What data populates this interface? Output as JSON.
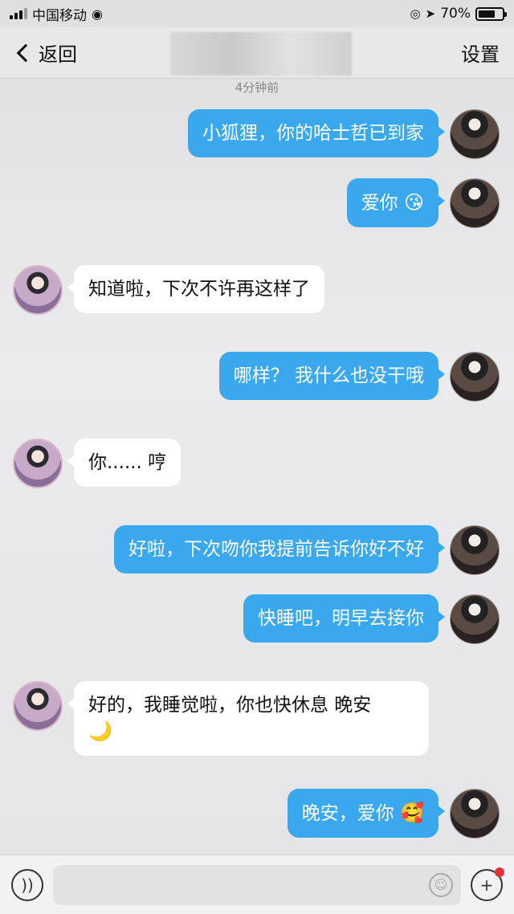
{
  "status_bar": {
    "carrier": "中国移动",
    "battery": "70%",
    "battery_level": 0.7
  },
  "nav": {
    "back_label": "返回",
    "settings_label": "设置"
  },
  "chat": {
    "timestamp": "4分钟前",
    "messages": [
      {
        "side": "out",
        "text": "小狐狸，你的哈士哲已到家",
        "emoji": ""
      },
      {
        "side": "out",
        "text": "爱你",
        "emoji": "😘"
      },
      {
        "side": "in",
        "text": "知道啦，下次不许再这样了",
        "emoji": ""
      },
      {
        "side": "out",
        "text": "哪样？ 我什么也没干哦",
        "emoji": ""
      },
      {
        "side": "in",
        "text": "你...... 哼",
        "emoji": ""
      },
      {
        "side": "out",
        "text": "好啦，下次吻你我提前告诉你好不好",
        "emoji": ""
      },
      {
        "side": "out",
        "text": "快睡吧，明早去接你",
        "emoji": ""
      },
      {
        "side": "in",
        "text": "好的，我睡觉啦，你也快休息 晚安",
        "emoji": "🌙"
      },
      {
        "side": "out",
        "text": "晚安，爱你",
        "emoji": "🥰"
      }
    ]
  },
  "icons": {
    "voice": "voice-icon",
    "emoji": "emoji-icon",
    "plus": "plus-icon"
  },
  "colors": {
    "outgoing_bubble": "#3aa8ee",
    "incoming_bubble": "#ffffff",
    "notification_dot": "#e0303a"
  }
}
